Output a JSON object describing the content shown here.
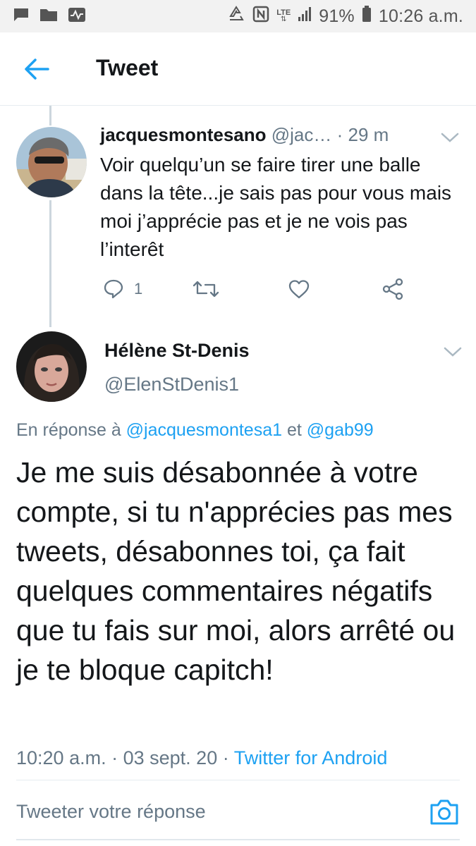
{
  "status_bar": {
    "network": "LTE",
    "battery": "91%",
    "time": "10:26 a.m."
  },
  "header": {
    "title": "Tweet"
  },
  "tweet1": {
    "name": "jacquesmontesano",
    "handle": "@jac…",
    "separator": "·",
    "age": "29 m",
    "text": "Voir quelqu’un se faire tirer une balle dans la tête...je sais pas pour vous mais moi j’apprécie pas et je ne vois pas l’interêt",
    "reply_count": "1"
  },
  "tweet2": {
    "name": "Hélène St-Denis",
    "handle": "@ElenStDenis1",
    "reply_prefix": "En réponse à",
    "mention1": "@jacquesmontesa1",
    "conjunction": "et",
    "mention2": "@gab99",
    "text": "Je me suis désabonnée à votre compte, si tu n'apprécies pas mes tweets, désabonnes toi, ça fait quelques commentaires négatifs que tu fais sur moi, alors arrêté ou je te bloque capitch!",
    "time": "10:20 a.m.",
    "separator": "·",
    "date": "03 sept. 20",
    "separator2": "·",
    "client": "Twitter for Android"
  },
  "composer": {
    "placeholder": "Tweeter votre réponse"
  },
  "colors": {
    "accent": "#1da1f2",
    "secondary_text": "#657786",
    "primary_text": "#14171a"
  },
  "icons": [
    "back-arrow-icon",
    "chevron-down-icon",
    "reply-icon",
    "retweet-icon",
    "like-icon",
    "share-icon",
    "camera-icon",
    "message-icon",
    "folder-icon",
    "activity-icon",
    "recycle-icon",
    "nfc-icon",
    "signal-icon",
    "battery-icon"
  ]
}
